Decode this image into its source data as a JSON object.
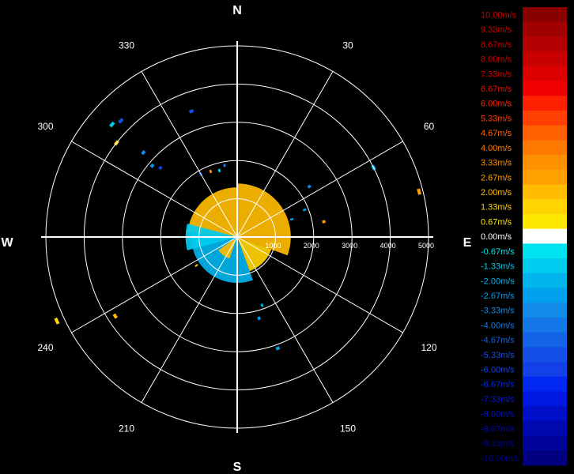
{
  "chart_data": {
    "type": "polar-radar-velocity",
    "compass": {
      "north": "N",
      "east": "E",
      "south": "S",
      "west": "W"
    },
    "bearing_labels": [
      {
        "deg": 30,
        "label": "30"
      },
      {
        "deg": 60,
        "label": "60"
      },
      {
        "deg": 120,
        "label": "120"
      },
      {
        "deg": 150,
        "label": "150"
      },
      {
        "deg": 210,
        "label": "210"
      },
      {
        "deg": 240,
        "label": "240"
      },
      {
        "deg": 300,
        "label": "300"
      },
      {
        "deg": 330,
        "label": "330"
      }
    ],
    "range_rings": [
      1000,
      2000,
      3000,
      4000,
      5000
    ],
    "range_tick_labels": [
      "1000",
      "2000",
      "3000",
      "4000",
      "5000"
    ],
    "spokes_deg": [
      0,
      30,
      60,
      90,
      120,
      150,
      180,
      210,
      240,
      270,
      300,
      330
    ],
    "echo_regions": [
      {
        "bearing_start": 275,
        "bearing_end": 360,
        "r_start": 0,
        "r_end": 1300,
        "velocity": 2.0
      },
      {
        "bearing_start": 0,
        "bearing_end": 110,
        "r_start": 0,
        "r_end": 1400,
        "velocity": 2.3
      },
      {
        "bearing_start": 110,
        "bearing_end": 160,
        "r_start": 0,
        "r_end": 950,
        "velocity": 1.5
      },
      {
        "bearing_start": 160,
        "bearing_end": 275,
        "r_start": 0,
        "r_end": 1200,
        "velocity": -2.2
      },
      {
        "bearing_start": 255,
        "bearing_end": 285,
        "r_start": 0,
        "r_end": 1350,
        "velocity": -1.5
      },
      {
        "bearing_start": 200,
        "bearing_end": 235,
        "r_start": 100,
        "r_end": 600,
        "velocity": 2.0
      }
    ],
    "echo_points": [
      {
        "bearing": 312,
        "range": 4400,
        "velocity": -1.3
      },
      {
        "bearing": 308,
        "range": 4000,
        "velocity": 1.3
      },
      {
        "bearing": 315,
        "range": 4300,
        "velocity": -5.3
      },
      {
        "bearing": 340,
        "range": 3500,
        "velocity": -5.3
      },
      {
        "bearing": 312,
        "range": 3300,
        "velocity": -3.3
      },
      {
        "bearing": 310,
        "range": 2900,
        "velocity": -2.7
      },
      {
        "bearing": 312,
        "range": 2700,
        "velocity": -6.0
      },
      {
        "bearing": 330,
        "range": 1900,
        "velocity": -5.3
      },
      {
        "bearing": 338,
        "range": 1850,
        "velocity": 3.3
      },
      {
        "bearing": 345,
        "range": 1800,
        "velocity": -1.3
      },
      {
        "bearing": 350,
        "range": 1900,
        "velocity": -4.0
      },
      {
        "bearing": 63,
        "range": 4000,
        "velocity": -2.0
      },
      {
        "bearing": 55,
        "range": 2300,
        "velocity": -3.3
      },
      {
        "bearing": 68,
        "range": 1900,
        "velocity": -2.7
      },
      {
        "bearing": 72,
        "range": 1500,
        "velocity": -2.0
      },
      {
        "bearing": 76,
        "range": 4900,
        "velocity": 2.7
      },
      {
        "bearing": 80,
        "range": 2300,
        "velocity": 2.7
      },
      {
        "bearing": 160,
        "range": 1900,
        "velocity": -2.0
      },
      {
        "bearing": 165,
        "range": 2200,
        "velocity": -2.7
      },
      {
        "bearing": 160,
        "range": 3100,
        "velocity": -2.7
      },
      {
        "bearing": 173,
        "range": 1000,
        "velocity": -2.0
      },
      {
        "bearing": 237,
        "range": 3800,
        "velocity": 2.0
      },
      {
        "bearing": 245,
        "range": 5200,
        "velocity": 1.3
      },
      {
        "bearing": 235,
        "range": 1300,
        "velocity": 1.3
      }
    ],
    "legend": {
      "labels": [
        "10.00m/s",
        "9.33m/s",
        "8.67m/s",
        "8.00m/s",
        "7.33m/s",
        "6.67m/s",
        "6.00m/s",
        "5.33m/s",
        "4.67m/s",
        "4.00m/s",
        "3.33m/s",
        "2.67m/s",
        "2.00m/s",
        "1.33m/s",
        "0.67m/s",
        "0.00m/s",
        "-0.67m/s",
        "-1.33m/s",
        "-2.00m/s",
        "-2.67m/s",
        "-3.33m/s",
        "-4.00m/s",
        "-4.67m/s",
        "-5.33m/s",
        "-6.00m/s",
        "-6.67m/s",
        "-7.33m/s",
        "-8.00m/s",
        "-8.67m/s",
        "-9.33m/s",
        "-10.00m/s"
      ],
      "values": [
        10,
        9.33,
        8.67,
        8,
        7.33,
        6.67,
        6,
        5.33,
        4.67,
        4,
        3.33,
        2.67,
        2,
        1.33,
        0.67,
        0,
        -0.67,
        -1.33,
        -2,
        -2.67,
        -3.33,
        -4,
        -4.67,
        -5.33,
        -6,
        -6.67,
        -7.33,
        -8,
        -8.67,
        -9.33,
        -10
      ],
      "colors": [
        "#8a0000",
        "#a00000",
        "#b40000",
        "#c80000",
        "#dc0000",
        "#f00000",
        "#ff2000",
        "#ff4000",
        "#ff6000",
        "#ff7800",
        "#ff9000",
        "#ffa000",
        "#ffbc00",
        "#ffd400",
        "#ffe800",
        "#ffffff",
        "#00e4f0",
        "#00ccf0",
        "#00b4ec",
        "#00a0ec",
        "#108ce8",
        "#1478e8",
        "#1464e8",
        "#1450e8",
        "#1440e8",
        "#0028f0",
        "#0018e0",
        "#0010c8",
        "#0008b0",
        "#000498",
        "#000080"
      ],
      "label_colors": [
        "#c80000",
        "#c80000",
        "#c80000",
        "#c80000",
        "#d80000",
        "#e81000",
        "#ff2000",
        "#ff4000",
        "#ff6000",
        "#ff7800",
        "#ff9000",
        "#ffa000",
        "#ffbc00",
        "#ffd400",
        "#ffe800",
        "#ffffff",
        "#00e4f0",
        "#00ccf0",
        "#00b4ec",
        "#00a0ec",
        "#108ce8",
        "#1478e8",
        "#1464e8",
        "#1450e8",
        "#1440e8",
        "#0028f0",
        "#0018e0",
        "#0010c8",
        "#0008b0",
        "#000498",
        "#000080"
      ]
    }
  }
}
